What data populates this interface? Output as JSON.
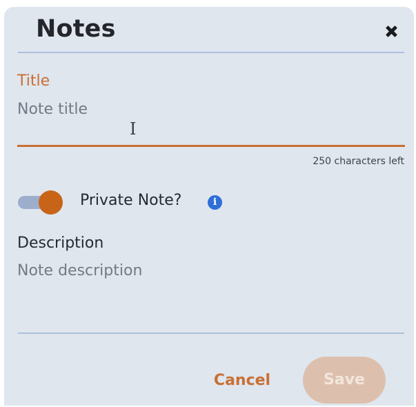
{
  "dialog": {
    "title": "Notes",
    "close_icon": "close-icon"
  },
  "title_field": {
    "label": "Title",
    "placeholder": "Note title",
    "counter": "250 characters left",
    "accent_color": "#c96f34"
  },
  "private_toggle": {
    "label": "Private Note?",
    "state": "on",
    "info_icon": "info-icon",
    "info_glyph": "i"
  },
  "description_field": {
    "label": "Description",
    "placeholder": "Note description"
  },
  "footer": {
    "cancel_label": "Cancel",
    "save_label": "Save",
    "save_state": "disabled"
  },
  "colors": {
    "panel": "#dfe6ee",
    "accent": "#c96f34",
    "divider": "#aebfdd",
    "info": "#2f6fd8"
  }
}
